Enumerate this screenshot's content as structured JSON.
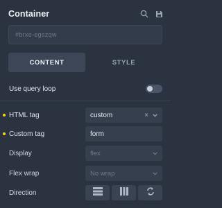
{
  "header": {
    "title": "Container",
    "icons": [
      "search-icon",
      "save-icon"
    ]
  },
  "element_id": {
    "value": "#brxe-egszqw"
  },
  "tabs": [
    {
      "label": "CONTENT",
      "active": true
    },
    {
      "label": "STYLE",
      "active": false
    }
  ],
  "controls": {
    "query_loop": {
      "label": "Use query loop",
      "enabled": false
    },
    "html_tag": {
      "label": "HTML tag",
      "value": "custom",
      "clear_symbol": "×",
      "modified": true
    },
    "custom_tag": {
      "label": "Custom tag",
      "value": "form",
      "modified": true
    },
    "display": {
      "label": "Display",
      "placeholder": "flex"
    },
    "flex_wrap": {
      "label": "Flex wrap",
      "placeholder": "No wrap"
    },
    "direction": {
      "label": "Direction",
      "options": [
        "rows-icon",
        "columns-icon",
        "reverse-icon"
      ]
    }
  },
  "colors": {
    "background": "#2b3340",
    "modified_indicator": "#f0d60f",
    "active_tab": "#3c4656"
  }
}
